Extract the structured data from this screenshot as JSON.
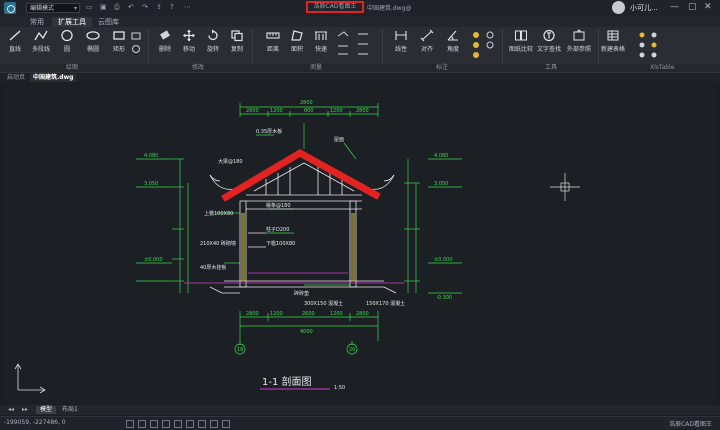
{
  "titlebar": {
    "mode": "编辑模式",
    "app_title": "浩辰CAD看图王",
    "file_title": "中国建筑.dwg@",
    "user_name": "小可儿..."
  },
  "ribbon_tabs": [
    "常用",
    "扩展工具",
    "云图库"
  ],
  "tools": [
    {
      "label": "直线",
      "icon": "line-icon"
    },
    {
      "label": "多段线",
      "icon": "polyline-icon"
    },
    {
      "label": "圆",
      "icon": "circle-icon"
    },
    {
      "label": "椭圆",
      "icon": "ellipse-icon"
    },
    {
      "label": "矩形",
      "icon": "rectangle-icon"
    },
    {
      "label": "删除",
      "icon": "eraser-icon"
    },
    {
      "label": "移动",
      "icon": "move-icon"
    },
    {
      "label": "旋转",
      "icon": "rotate-icon"
    },
    {
      "label": "复制",
      "icon": "copy-icon"
    },
    {
      "label": "距离",
      "icon": "distance-icon"
    },
    {
      "label": "面积",
      "icon": "area-icon"
    },
    {
      "label": "快速",
      "icon": "quick-measure-icon"
    },
    {
      "label": "线性",
      "icon": "linear-dimension-icon"
    },
    {
      "label": "对齐",
      "icon": "aligned-dimension-icon"
    },
    {
      "label": "角度",
      "icon": "angle-dimension-icon"
    },
    {
      "label": "图纸比较",
      "icon": "compare-icon"
    },
    {
      "label": "文字查找",
      "icon": "text-search-icon"
    },
    {
      "label": "外部参照",
      "icon": "xref-icon"
    },
    {
      "label": "新建表格",
      "icon": "new-table-icon"
    }
  ],
  "groups": [
    "绘图",
    "修改",
    "测量",
    "标注",
    "工具",
    "XlsTable"
  ],
  "doc_tabs": [
    "启动页",
    "中国建筑.dwg"
  ],
  "drawing": {
    "title": "1-1    剖面图",
    "scale": "1:50",
    "dims_top": [
      "2800",
      "1200",
      "600",
      "1200",
      "2800"
    ],
    "dims_bottom": [
      "2800",
      "1200",
      "2600",
      "1200",
      "2800"
    ],
    "dims_total": "4000",
    "axis_left": "18",
    "axis_right": "20",
    "elevations": [
      "4.080",
      "3.050",
      "±0.000",
      "-0.300"
    ],
    "notes": [
      "0.35厚木板",
      "大梁@180",
      "屋面",
      "上檐100X80",
      "椽条@180",
      "柱子D200",
      "下槛100X80",
      "40厚木挂板",
      "210X40 砖砌墙",
      "碎砖垫",
      "300X150 混凝土",
      "150X170 混凝土"
    ]
  },
  "layout_tabs": [
    "模型",
    "布局1"
  ],
  "status": {
    "coords": "-199059, -227486, 0",
    "brand": "浩辰CAD看图王"
  },
  "colors": {
    "canvas": "#1c2025",
    "highlight": "#e32222",
    "cad_green": "#39d84a",
    "cad_white": "#e6e6e6"
  }
}
